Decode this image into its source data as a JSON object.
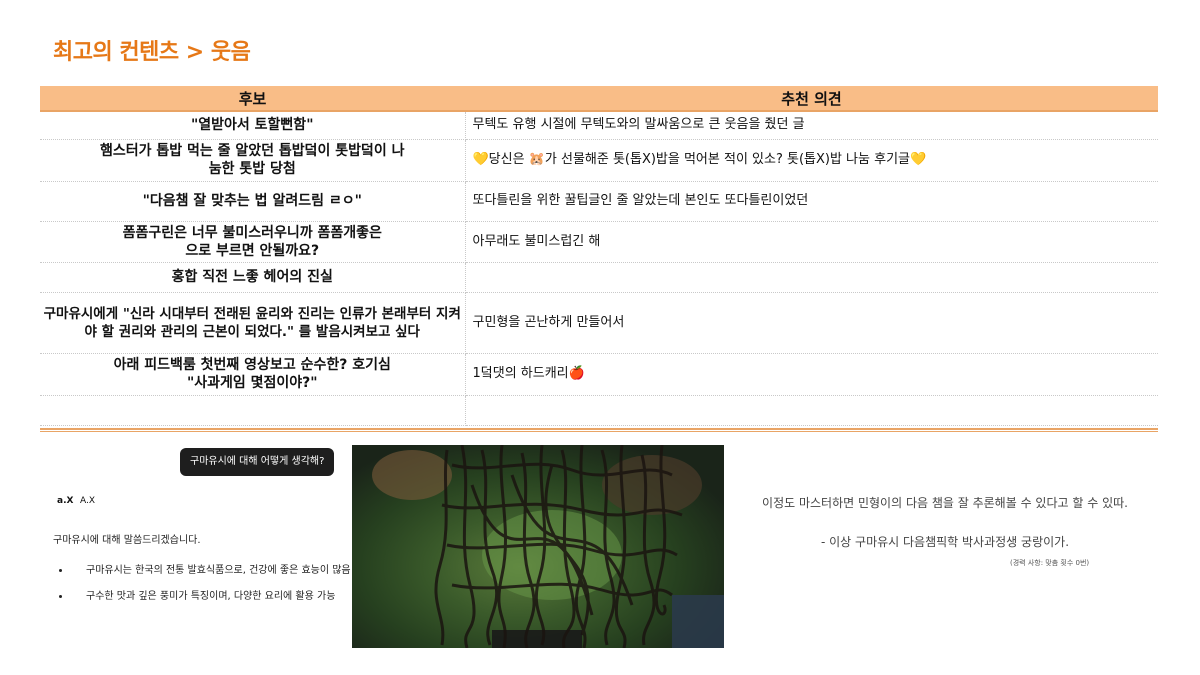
{
  "page": {
    "title": "최고의 컨텐츠 > 웃음"
  },
  "table": {
    "headers": [
      "후보",
      "추천 의견"
    ],
    "rows": [
      {
        "candidate": "\"열받아서 토할뻔함\"",
        "opinion": "무텍도 유행 시절에 무텍도와의 말싸움으로 큰 웃음을 줬던 글"
      },
      {
        "candidate": "햄스터가 톱밥 먹는 줄 알았던 톱밥덬이 톳밥덬이 나눔한 톳밥 당첨",
        "opinion": "💛당신은 🐹가 선물해준 톳(톱X)밥을 먹어본 적이 있소? 톳(톱X)밥 나눔 후기글💛"
      },
      {
        "candidate": "\"다음챔 잘 맞추는 법 알려드림 ㄹㅇ\"",
        "opinion": "또다틀린을 위한 꿀팁글인 줄 알았는데 본인도 또다틀린이었던"
      },
      {
        "candidate": "폼폼구린은 너무 불미스러우니까 폼폼개좋은으로 부르면 안될까요?",
        "opinion": "아무래도 불미스럽긴 해"
      },
      {
        "candidate": "홍합 직전 느좋 헤어의 진실",
        "opinion": ""
      },
      {
        "candidate": "구마유시에게 \"신라 시대부터 전래된 윤리와 진리는 인류가 본래부터 지켜야 할 권리와 관리의 근본이 되었다.\" 를 발음시켜보고 싶다",
        "opinion": "구민형을 곤난하게 만들어서"
      },
      {
        "candidate": "아래 피드백룸 첫번째 영상보고 순수한? 호기심 \"사과게임 몇점이야?\"",
        "opinion": "1덬댓의 하드캐리🍎"
      },
      {
        "candidate": "",
        "opinion": ""
      }
    ]
  },
  "chat": {
    "user_message": "구마유시에 대해 어떻게 생각해?",
    "bot_logo": "a.X",
    "bot_name": "A.X",
    "intro": "구마유시에 대해 말씀드리겠습니다.",
    "bullets": [
      "구마유시는 한국의 전통 발효식품으로, 건강에 좋은 효능이 많음",
      "구수한 맛과 깊은 풍미가 특징이며, 다양한 요리에 활용 가능"
    ]
  },
  "caption": {
    "quote": "이정도 마스터하면 민형이의 다음 챔을 잘 추론해볼 수 있다고 할 수 있따.",
    "signature": "- 이상 구마유시 다음챔픽학 박사과정생 궁랑이가.",
    "note": "(경력 사항: 맞춤 횟수 0번)"
  }
}
